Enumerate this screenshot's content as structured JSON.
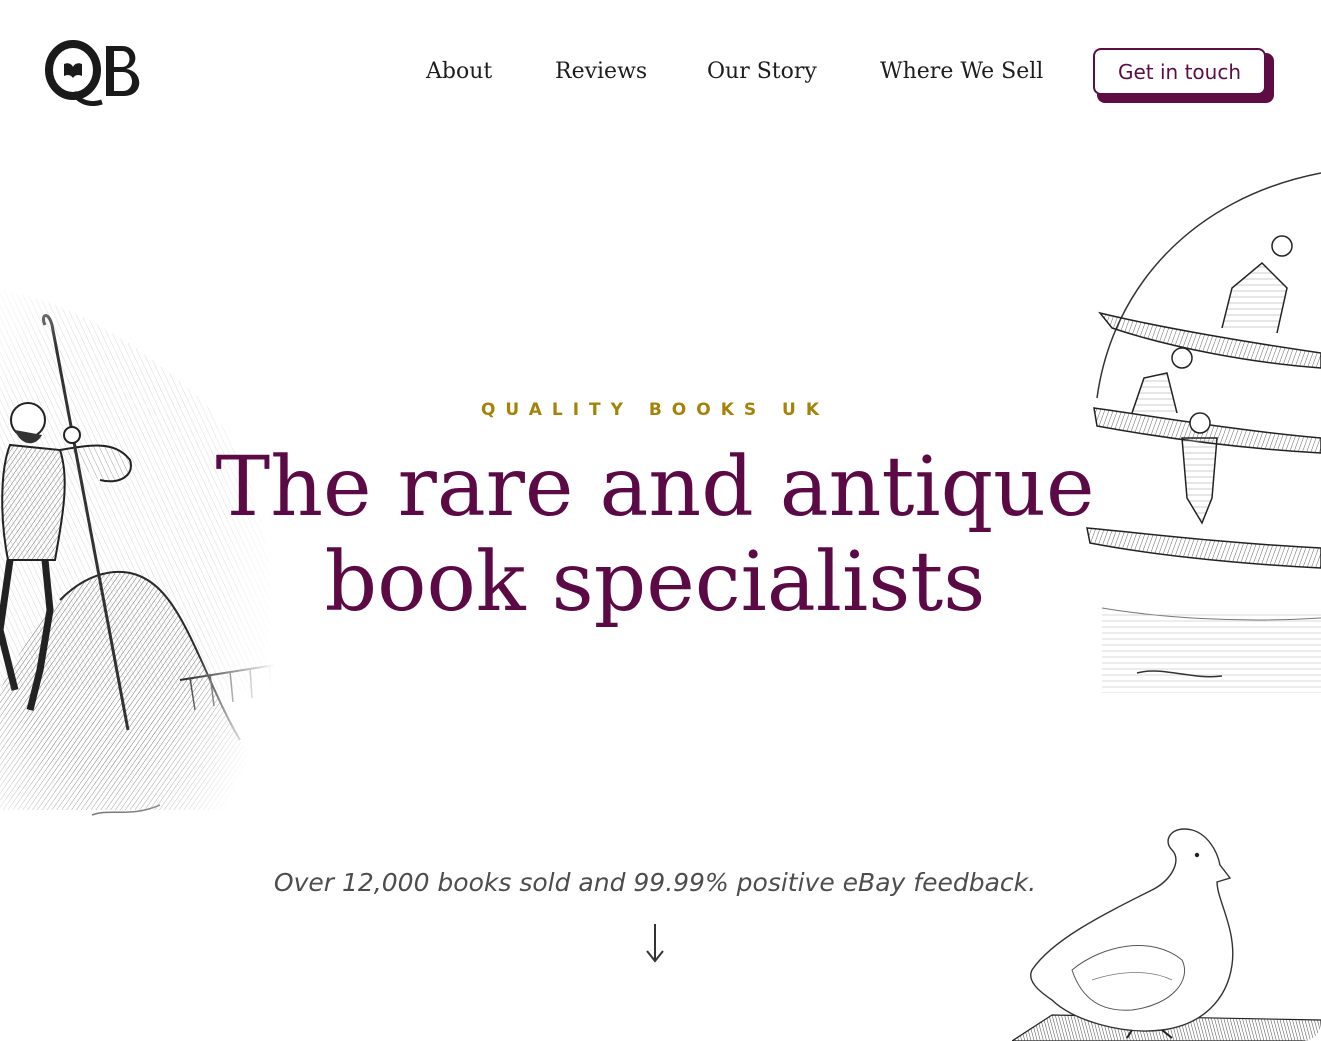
{
  "header": {
    "logo_text": "QB",
    "nav": {
      "about": "About",
      "reviews": "Reviews",
      "our_story": "Our Story",
      "where_we_sell": "Where We Sell"
    },
    "cta_label": "Get in touch"
  },
  "hero": {
    "eyebrow": "QUALITY BOOKS UK",
    "headline": "The rare and antique book specialists",
    "subline": "Over 12,000 books sold and 99.99% positive eBay feedback.",
    "arrow_icon": "arrow-down-icon"
  },
  "colors": {
    "brand": "#5c0a45",
    "accent_gold": "#a58208",
    "text": "#1d1d1d",
    "muted": "#4d4d4d"
  },
  "illustrations": {
    "left": "mountaineer-engraving",
    "right": "canoes-engraving",
    "bottom_right": "duck-engraving"
  }
}
